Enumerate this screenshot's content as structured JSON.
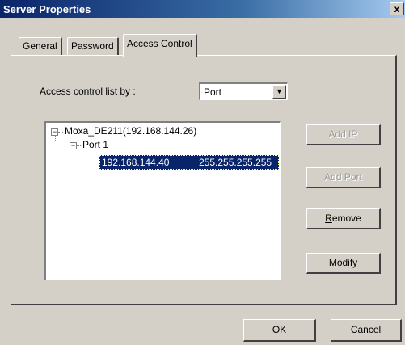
{
  "window": {
    "title": "Server Properties",
    "close_glyph": "x"
  },
  "tabs": [
    {
      "label": "General",
      "active": false
    },
    {
      "label": "Password",
      "active": false
    },
    {
      "label": "Access Control",
      "active": true
    }
  ],
  "access": {
    "label": "Access control list by :",
    "selected": "Port"
  },
  "tree": {
    "root_label": "Moxa_DE211(192.168.144.26)",
    "child_label": "Port 1",
    "entry_ip": "192.168.144.40",
    "entry_mask": "255.255.255.255"
  },
  "side_buttons": {
    "add_ip": "Add IP",
    "add_port": "Add Port",
    "remove_first": "R",
    "remove_rest": "emove",
    "modify_first": "M",
    "modify_rest": "odify"
  },
  "footer": {
    "ok": "OK",
    "cancel": "Cancel"
  }
}
